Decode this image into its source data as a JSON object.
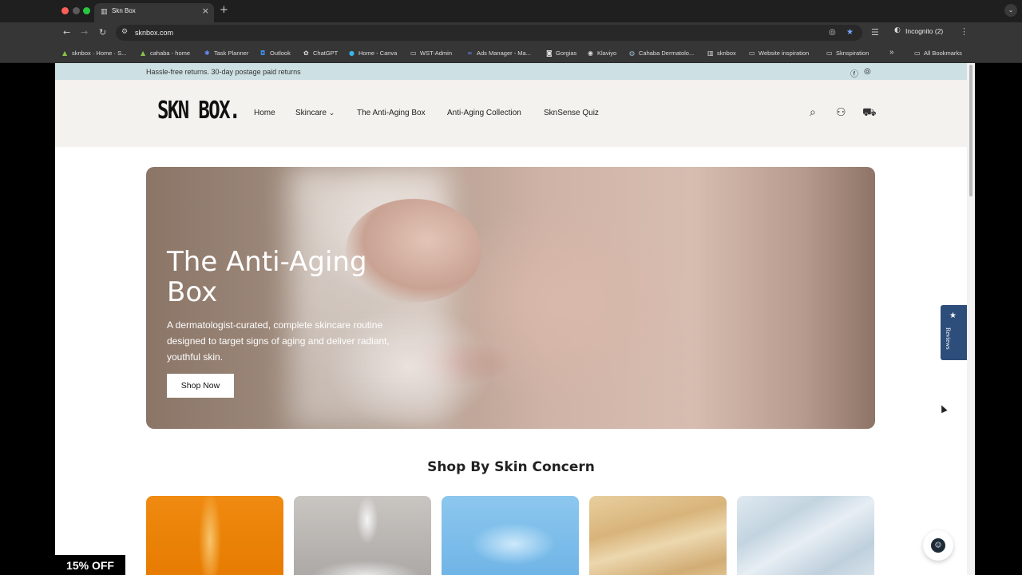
{
  "browser": {
    "tab_title": "Skn Box",
    "tab_close": "×",
    "new_tab": "+",
    "url": "sknbox.com",
    "incognito_label": "Incognito (2)",
    "bookmarks": [
      {
        "label": "sknbox · Home · S...",
        "icon": "shop-icon"
      },
      {
        "label": "cahaba - home",
        "icon": "shop-icon"
      },
      {
        "label": "Task Planner",
        "icon": "planner-icon"
      },
      {
        "label": "Outlook",
        "icon": "outlook-icon"
      },
      {
        "label": "ChatGPT",
        "icon": "chatgpt-icon"
      },
      {
        "label": "Home - Canva",
        "icon": "canva-icon"
      },
      {
        "label": "WST-Admin",
        "icon": "folder-icon"
      },
      {
        "label": "Ads Manager - Ma...",
        "icon": "meta-icon"
      },
      {
        "label": "Gorgias",
        "icon": "gorgias-icon"
      },
      {
        "label": "Klaviyo",
        "icon": "klaviyo-icon"
      },
      {
        "label": "Cahaba Dermatolo...",
        "icon": "cahaba-icon"
      },
      {
        "label": "sknbox",
        "icon": "sknbox-icon"
      },
      {
        "label": "Website inspiration",
        "icon": "folder-icon"
      },
      {
        "label": "Sknspiration",
        "icon": "folder-icon"
      }
    ],
    "overflow": "»",
    "all_bookmarks": "All Bookmarks"
  },
  "announcement": {
    "text": "Hassle-free returns. 30-day postage paid returns"
  },
  "header": {
    "logo": "SKN BOX.",
    "nav": [
      "Home",
      "Skincare",
      "The Anti-Aging Box",
      "Anti-Aging Collection",
      "SknSense Quiz"
    ],
    "skincare_chevron": "⌄"
  },
  "hero": {
    "title": "The Anti-Aging Box",
    "description": "A dermatologist-curated, complete skincare routine designed to target signs of aging and deliver radiant, youthful skin.",
    "button": "Shop Now"
  },
  "concern_section": {
    "title": "Shop By Skin Concern"
  },
  "widgets": {
    "reviews_star": "★",
    "reviews_label": "Reviews",
    "discount": "15% OFF"
  },
  "colors": {
    "announcement_bg": "#cde0e3",
    "header_bg": "#f3f2ee",
    "reviews_bg": "#2d4d7a"
  }
}
